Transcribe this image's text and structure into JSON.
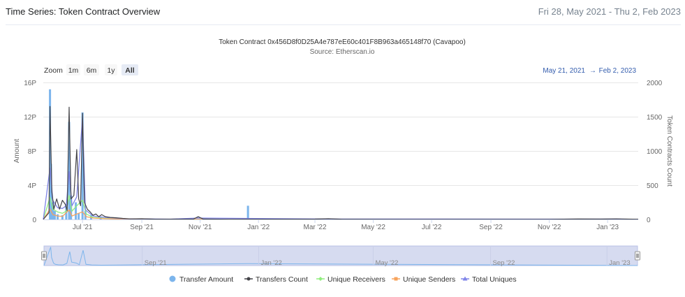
{
  "header": {
    "title": "Time Series: Token Contract Overview",
    "date_range": "Fri 28, May 2021 - Thu 2, Feb 2023"
  },
  "zoom": {
    "label": "Zoom",
    "buttons": [
      "1m",
      "6m",
      "1y",
      "All"
    ],
    "active": "All",
    "from": "May 21, 2021",
    "separator": "→",
    "to": "Feb 2, 2023"
  },
  "colors": {
    "transfer_amount": "#7cb5ec",
    "transfers_count": "#434348",
    "unique_receivers": "#90ed7d",
    "unique_senders": "#f7a35c",
    "total_uniques": "#8085e9",
    "navigator_fill": "#d6dbf0"
  },
  "chart_data": {
    "type": "line",
    "title": "Token Contract 0x456D8f0D25A4e787eE60c401F8B963a465148f70 (Cavapoo)",
    "subtitle": "Source: Etherscan.io",
    "ylabel_left": "Amount",
    "ylabel_right": "Token Contracts Count",
    "ylim_left": [
      0,
      16
    ],
    "ylim_right": [
      0,
      2000
    ],
    "yticks_left": [
      "0",
      "4P",
      "8P",
      "12P",
      "16P"
    ],
    "yticks_right": [
      "0",
      "500",
      "1000",
      "1500",
      "2000"
    ],
    "xlim": [
      "2021-05-21",
      "2023-02-02"
    ],
    "xticks": [
      {
        "date": "2021-07-01",
        "label": "Jul '21"
      },
      {
        "date": "2021-09-01",
        "label": "Sep '21"
      },
      {
        "date": "2021-11-01",
        "label": "Nov '21"
      },
      {
        "date": "2022-01-01",
        "label": "Jan '22"
      },
      {
        "date": "2022-03-01",
        "label": "Mar '22"
      },
      {
        "date": "2022-05-01",
        "label": "May '22"
      },
      {
        "date": "2022-07-01",
        "label": "Jul '22"
      },
      {
        "date": "2022-09-01",
        "label": "Sep '22"
      },
      {
        "date": "2022-11-01",
        "label": "Nov '22"
      },
      {
        "date": "2023-01-01",
        "label": "Jan '23"
      }
    ],
    "navigator_ticks": [
      {
        "date": "2021-09-01",
        "label": "Sep '21"
      },
      {
        "date": "2022-01-01",
        "label": "Jan '22"
      },
      {
        "date": "2022-05-01",
        "label": "May '22"
      },
      {
        "date": "2022-09-01",
        "label": "Sep '22"
      },
      {
        "date": "2023-01-01",
        "label": "Jan '23"
      }
    ],
    "legend_position": "bottom",
    "grid": true,
    "series": [
      {
        "name": "Transfer Amount",
        "kind": "column",
        "axis": "left",
        "points": [
          [
            "2021-05-28",
            15.2
          ],
          [
            "2021-05-29",
            6.5
          ],
          [
            "2021-05-31",
            2.0
          ],
          [
            "2021-06-02",
            1.0
          ],
          [
            "2021-06-05",
            0.6
          ],
          [
            "2021-06-10",
            0.5
          ],
          [
            "2021-06-14",
            1.8
          ],
          [
            "2021-06-17",
            11.4
          ],
          [
            "2021-06-19",
            2.8
          ],
          [
            "2021-06-24",
            2.0
          ],
          [
            "2021-06-27",
            0.7
          ],
          [
            "2021-07-01",
            12.5
          ],
          [
            "2021-07-04",
            1.0
          ],
          [
            "2021-07-10",
            0.5
          ],
          [
            "2021-07-20",
            0.3
          ],
          [
            "2021-12-21",
            1.6
          ]
        ]
      },
      {
        "name": "Transfers Count",
        "kind": "line",
        "axis": "right",
        "points": [
          [
            "2021-05-21",
            0
          ],
          [
            "2021-05-27",
            100
          ],
          [
            "2021-05-28",
            1650
          ],
          [
            "2021-05-30",
            400
          ],
          [
            "2021-06-01",
            150
          ],
          [
            "2021-06-04",
            300
          ],
          [
            "2021-06-07",
            150
          ],
          [
            "2021-06-10",
            280
          ],
          [
            "2021-06-13",
            220
          ],
          [
            "2021-06-15",
            130
          ],
          [
            "2021-06-17",
            1640
          ],
          [
            "2021-06-19",
            300
          ],
          [
            "2021-06-22",
            350
          ],
          [
            "2021-06-25",
            1020
          ],
          [
            "2021-06-27",
            300
          ],
          [
            "2021-06-29",
            200
          ],
          [
            "2021-07-01",
            1550
          ],
          [
            "2021-07-03",
            250
          ],
          [
            "2021-07-06",
            150
          ],
          [
            "2021-07-09",
            110
          ],
          [
            "2021-07-12",
            60
          ],
          [
            "2021-07-15",
            80
          ],
          [
            "2021-07-18",
            40
          ],
          [
            "2021-07-21",
            70
          ],
          [
            "2021-07-25",
            40
          ],
          [
            "2021-07-30",
            30
          ],
          [
            "2021-08-05",
            25
          ],
          [
            "2021-08-12",
            15
          ],
          [
            "2021-08-20",
            8
          ],
          [
            "2021-09-01",
            10
          ],
          [
            "2021-09-15",
            4
          ],
          [
            "2021-10-01",
            4
          ],
          [
            "2021-10-25",
            6
          ],
          [
            "2021-10-30",
            40
          ],
          [
            "2021-11-04",
            6
          ],
          [
            "2021-12-01",
            3
          ],
          [
            "2022-01-15",
            4
          ],
          [
            "2022-03-01",
            5
          ],
          [
            "2022-03-15",
            10
          ],
          [
            "2022-03-30",
            3
          ],
          [
            "2022-06-01",
            2
          ],
          [
            "2022-09-01",
            2
          ],
          [
            "2022-11-01",
            2
          ],
          [
            "2022-12-01",
            6
          ],
          [
            "2022-12-25",
            5
          ],
          [
            "2023-01-10",
            8
          ],
          [
            "2023-02-02",
            3
          ]
        ]
      },
      {
        "name": "Unique Receivers",
        "kind": "line",
        "axis": "right",
        "points": [
          [
            "2021-05-21",
            0
          ],
          [
            "2021-05-28",
            320
          ],
          [
            "2021-05-31",
            150
          ],
          [
            "2021-06-05",
            110
          ],
          [
            "2021-06-10",
            90
          ],
          [
            "2021-06-14",
            120
          ],
          [
            "2021-06-17",
            350
          ],
          [
            "2021-06-20",
            120
          ],
          [
            "2021-06-25",
            200
          ],
          [
            "2021-07-01",
            280
          ],
          [
            "2021-07-05",
            80
          ],
          [
            "2021-07-12",
            30
          ],
          [
            "2021-07-25",
            15
          ],
          [
            "2021-08-15",
            5
          ],
          [
            "2021-10-01",
            3
          ],
          [
            "2022-03-15",
            3
          ],
          [
            "2023-02-02",
            1
          ]
        ]
      },
      {
        "name": "Unique Senders",
        "kind": "line",
        "axis": "right",
        "points": [
          [
            "2021-05-21",
            0
          ],
          [
            "2021-05-28",
            150
          ],
          [
            "2021-05-31",
            70
          ],
          [
            "2021-06-05",
            50
          ],
          [
            "2021-06-10",
            45
          ],
          [
            "2021-06-17",
            140
          ],
          [
            "2021-06-20",
            50
          ],
          [
            "2021-06-25",
            80
          ],
          [
            "2021-07-01",
            110
          ],
          [
            "2021-07-05",
            40
          ],
          [
            "2021-07-12",
            20
          ],
          [
            "2021-07-25",
            10
          ],
          [
            "2021-08-15",
            4
          ],
          [
            "2021-10-01",
            2
          ],
          [
            "2023-02-02",
            1
          ]
        ]
      },
      {
        "name": "Total Uniques",
        "kind": "line",
        "axis": "right",
        "points": [
          [
            "2021-05-21",
            0
          ],
          [
            "2021-05-28",
            750
          ],
          [
            "2021-05-31",
            280
          ],
          [
            "2021-06-05",
            170
          ],
          [
            "2021-06-10",
            160
          ],
          [
            "2021-06-14",
            200
          ],
          [
            "2021-06-17",
            700
          ],
          [
            "2021-06-20",
            200
          ],
          [
            "2021-06-25",
            330
          ],
          [
            "2021-07-01",
            1500
          ],
          [
            "2021-07-04",
            140
          ],
          [
            "2021-07-12",
            50
          ],
          [
            "2021-07-25",
            30
          ],
          [
            "2021-08-15",
            10
          ],
          [
            "2021-10-01",
            5
          ],
          [
            "2021-10-30",
            20
          ],
          [
            "2022-03-15",
            6
          ],
          [
            "2022-12-01",
            5
          ],
          [
            "2023-01-10",
            6
          ],
          [
            "2023-02-02",
            2
          ]
        ]
      }
    ]
  }
}
